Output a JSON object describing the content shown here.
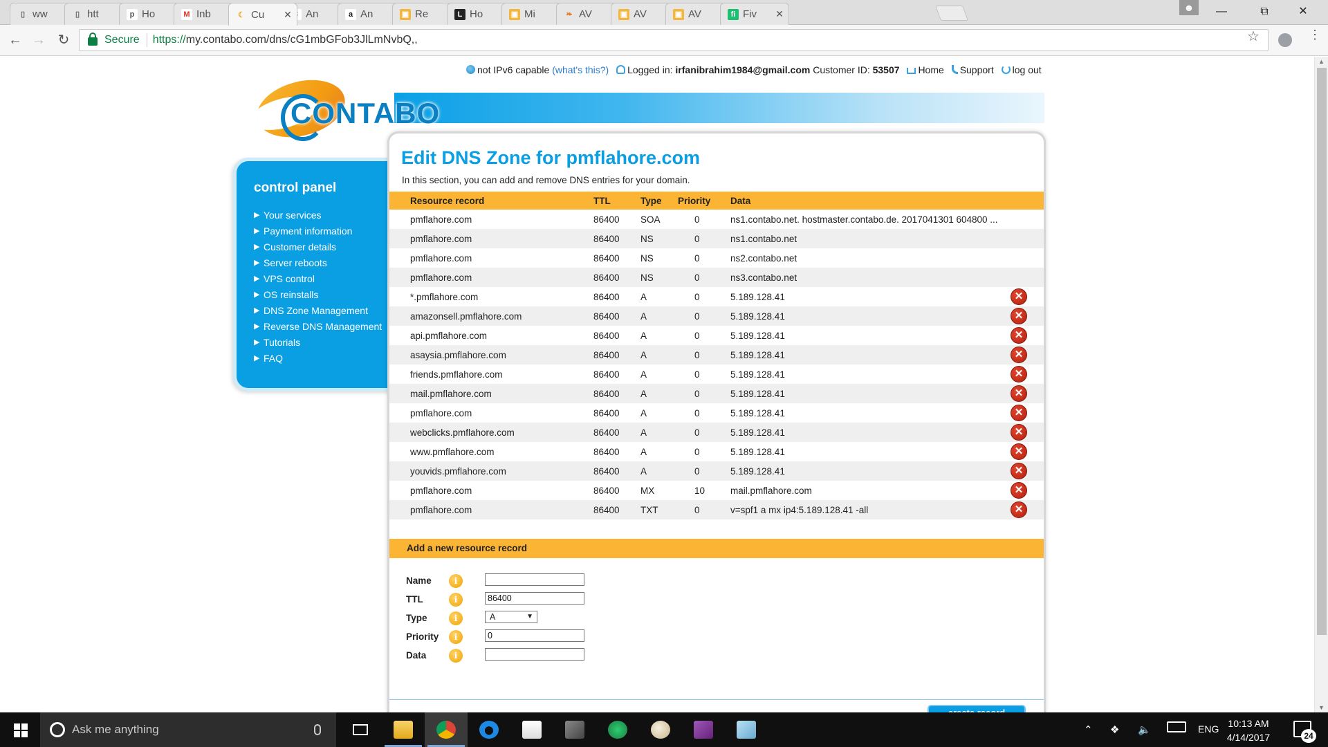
{
  "browser": {
    "tabs": [
      {
        "label": "ww",
        "icon": "page-icon"
      },
      {
        "label": "htt",
        "icon": "page-icon"
      },
      {
        "label": "Ho",
        "icon": "plesk-icon"
      },
      {
        "label": "Inb",
        "icon": "gmail-icon"
      },
      {
        "label": "Cu",
        "icon": "contabo-icon"
      },
      {
        "label": "An",
        "icon": "doc-icon"
      },
      {
        "label": "An",
        "icon": "amazon-icon"
      },
      {
        "label": "Re",
        "icon": "aws-icon"
      },
      {
        "label": "Ho",
        "icon": "l-icon"
      },
      {
        "label": "Mi",
        "icon": "aws-icon"
      },
      {
        "label": "AV",
        "icon": "feather-icon"
      },
      {
        "label": "AV",
        "icon": "aws-icon"
      },
      {
        "label": "AV",
        "icon": "aws-icon"
      },
      {
        "label": "Fiv",
        "icon": "fiverr-icon"
      }
    ],
    "active_tab_index": 4,
    "secure_label": "Secure",
    "url_scheme": "https://",
    "url_rest": "my.contabo.com/dns/cG1mbGFob3JlLmNvbQ,,"
  },
  "topbar": {
    "ipv6_text": "not IPv6 capable",
    "whats_this": "(what's this?)",
    "logged_in_label": "Logged in:",
    "email": "irfanibrahim1984@gmail.com",
    "customer_id_label": "Customer ID:",
    "customer_id": "53507",
    "home": "Home",
    "support": "Support",
    "logout": "log out"
  },
  "logo": {
    "text": "CONTABO"
  },
  "sidebar": {
    "title": "control panel",
    "items": [
      "Your services",
      "Payment information",
      "Customer details",
      "Server reboots",
      "VPS control",
      "OS reinstalls",
      "DNS Zone Management",
      "Reverse DNS Management",
      "Tutorials",
      "FAQ"
    ]
  },
  "main": {
    "title": "Edit DNS Zone for pmflahore.com",
    "intro": "In this section, you can add and remove DNS entries for your domain.",
    "columns": [
      "Resource record",
      "TTL",
      "Type",
      "Priority",
      "Data"
    ],
    "records": [
      {
        "name": "pmflahore.com",
        "ttl": "86400",
        "type": "SOA",
        "priority": "0",
        "data": "ns1.contabo.net. hostmaster.contabo.de. 2017041301 604800 ...",
        "deletable": false
      },
      {
        "name": "pmflahore.com",
        "ttl": "86400",
        "type": "NS",
        "priority": "0",
        "data": "ns1.contabo.net",
        "deletable": false
      },
      {
        "name": "pmflahore.com",
        "ttl": "86400",
        "type": "NS",
        "priority": "0",
        "data": "ns2.contabo.net",
        "deletable": false
      },
      {
        "name": "pmflahore.com",
        "ttl": "86400",
        "type": "NS",
        "priority": "0",
        "data": "ns3.contabo.net",
        "deletable": false
      },
      {
        "name": "*.pmflahore.com",
        "ttl": "86400",
        "type": "A",
        "priority": "0",
        "data": "5.189.128.41",
        "deletable": true
      },
      {
        "name": "amazonsell.pmflahore.com",
        "ttl": "86400",
        "type": "A",
        "priority": "0",
        "data": "5.189.128.41",
        "deletable": true
      },
      {
        "name": "api.pmflahore.com",
        "ttl": "86400",
        "type": "A",
        "priority": "0",
        "data": "5.189.128.41",
        "deletable": true
      },
      {
        "name": "asaysia.pmflahore.com",
        "ttl": "86400",
        "type": "A",
        "priority": "0",
        "data": "5.189.128.41",
        "deletable": true
      },
      {
        "name": "friends.pmflahore.com",
        "ttl": "86400",
        "type": "A",
        "priority": "0",
        "data": "5.189.128.41",
        "deletable": true
      },
      {
        "name": "mail.pmflahore.com",
        "ttl": "86400",
        "type": "A",
        "priority": "0",
        "data": "5.189.128.41",
        "deletable": true
      },
      {
        "name": "pmflahore.com",
        "ttl": "86400",
        "type": "A",
        "priority": "0",
        "data": "5.189.128.41",
        "deletable": true
      },
      {
        "name": "webclicks.pmflahore.com",
        "ttl": "86400",
        "type": "A",
        "priority": "0",
        "data": "5.189.128.41",
        "deletable": true
      },
      {
        "name": "www.pmflahore.com",
        "ttl": "86400",
        "type": "A",
        "priority": "0",
        "data": "5.189.128.41",
        "deletable": true
      },
      {
        "name": "youvids.pmflahore.com",
        "ttl": "86400",
        "type": "A",
        "priority": "0",
        "data": "5.189.128.41",
        "deletable": true
      },
      {
        "name": "pmflahore.com",
        "ttl": "86400",
        "type": "MX",
        "priority": "10",
        "data": "mail.pmflahore.com",
        "deletable": true
      },
      {
        "name": "pmflahore.com",
        "ttl": "86400",
        "type": "TXT",
        "priority": "0",
        "data": "v=spf1 a mx ip4:5.189.128.41 -all",
        "deletable": true
      }
    ],
    "add_section_title": "Add a new resource record",
    "form": {
      "name_label": "Name",
      "name_value": "",
      "ttl_label": "TTL",
      "ttl_value": "86400",
      "type_label": "Type",
      "type_value": "A",
      "priority_label": "Priority",
      "priority_value": "0",
      "data_label": "Data",
      "data_value": ""
    },
    "create_button": "create record"
  },
  "taskbar": {
    "search_placeholder": "Ask me anything",
    "apps": [
      "file-explorer-icon",
      "chrome-icon",
      "edge-icon",
      "store-icon",
      "tools-icon",
      "globe-app-icon",
      "paint-icon",
      "visual-studio-icon",
      "notepad-icon"
    ],
    "language": "ENG",
    "time": "10:13 AM",
    "date": "4/14/2017",
    "notifications": "24"
  },
  "colors": {
    "accent_blue": "#0a9ee3",
    "table_header": "#fbb433",
    "delete_red": "#c9301a"
  }
}
